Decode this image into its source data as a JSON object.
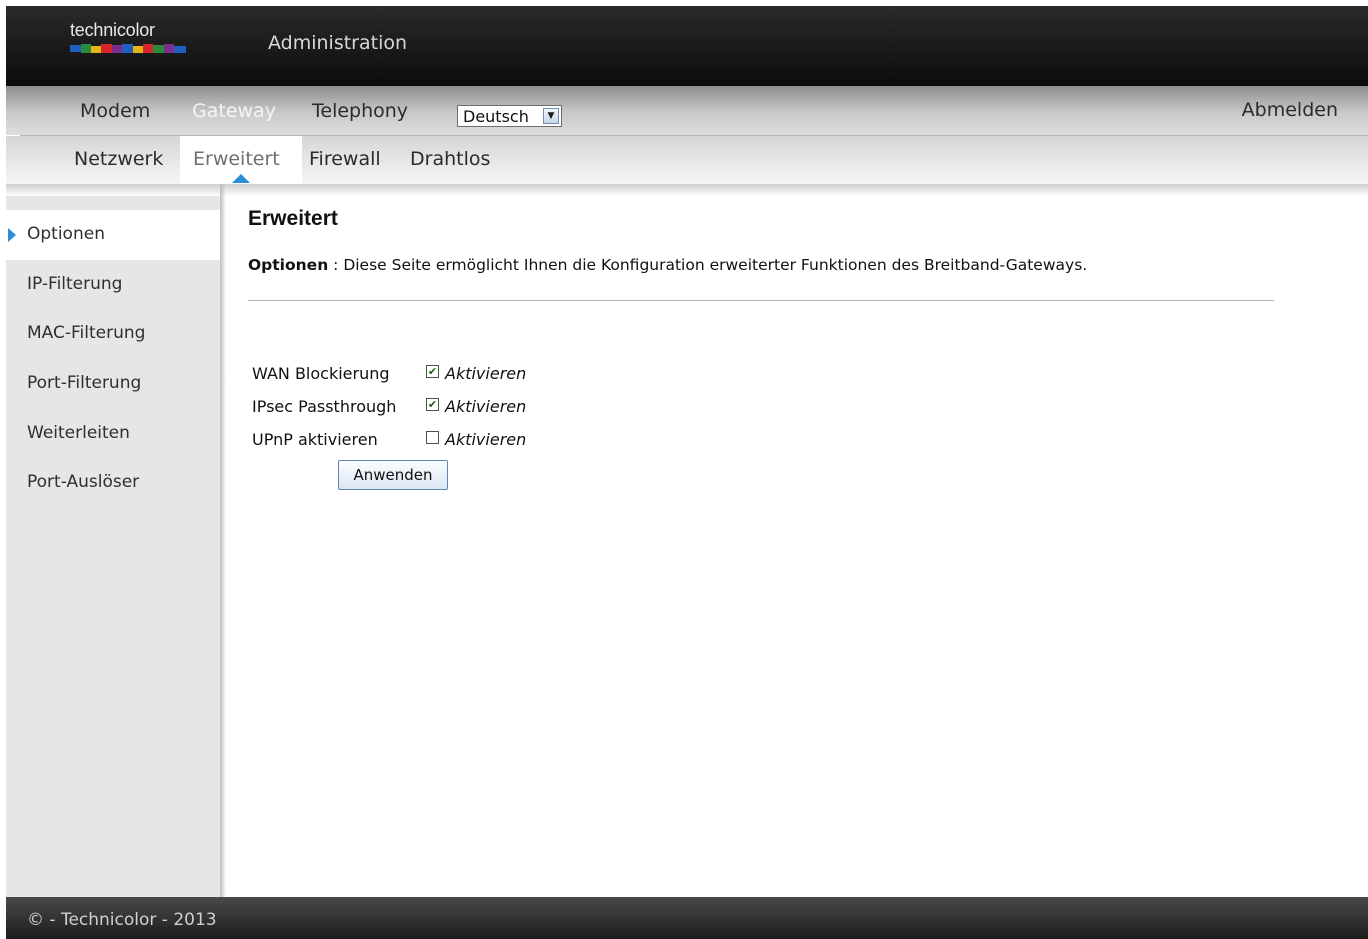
{
  "header": {
    "logo_text": "technicolor",
    "title": "Administration"
  },
  "main_nav": {
    "items": [
      {
        "label": "Modem",
        "active": false
      },
      {
        "label": "Gateway",
        "active": true
      },
      {
        "label": "Telephony",
        "active": false
      }
    ],
    "language": {
      "selected": "Deutsch"
    },
    "logout_label": "Abmelden"
  },
  "sub_nav": {
    "items": [
      {
        "label": "Netzwerk",
        "active": false
      },
      {
        "label": "Erweitert",
        "active": true
      },
      {
        "label": "Firewall",
        "active": false
      },
      {
        "label": "Drahtlos",
        "active": false
      }
    ]
  },
  "sidebar": {
    "items": [
      {
        "label": "Optionen",
        "active": true
      },
      {
        "label": "IP-Filterung",
        "active": false
      },
      {
        "label": "MAC-Filterung",
        "active": false
      },
      {
        "label": "Port-Filterung",
        "active": false
      },
      {
        "label": "Weiterleiten",
        "active": false
      },
      {
        "label": "Port-Auslöser",
        "active": false
      }
    ]
  },
  "content": {
    "title": "Erweitert",
    "description_label": "Optionen",
    "description_sep": " : ",
    "description_text": "Diese Seite ermöglicht Ihnen die Konfiguration erweiterter Funktionen des Breitband-Gateways.",
    "options": [
      {
        "label": "WAN Blockierung",
        "checkbox_label": "Aktivieren",
        "checked": true
      },
      {
        "label": "IPsec Passthrough",
        "checkbox_label": "Aktivieren",
        "checked": true
      },
      {
        "label": "UPnP aktivieren",
        "checkbox_label": "Aktivieren",
        "checked": false
      }
    ],
    "apply_label": "Anwenden"
  },
  "footer": {
    "text": "© - Technicolor - 2013"
  },
  "colors": {
    "accent": "#2a8fd8",
    "header_bg": "#141414",
    "sidebar_bg": "#e6e6e6"
  }
}
